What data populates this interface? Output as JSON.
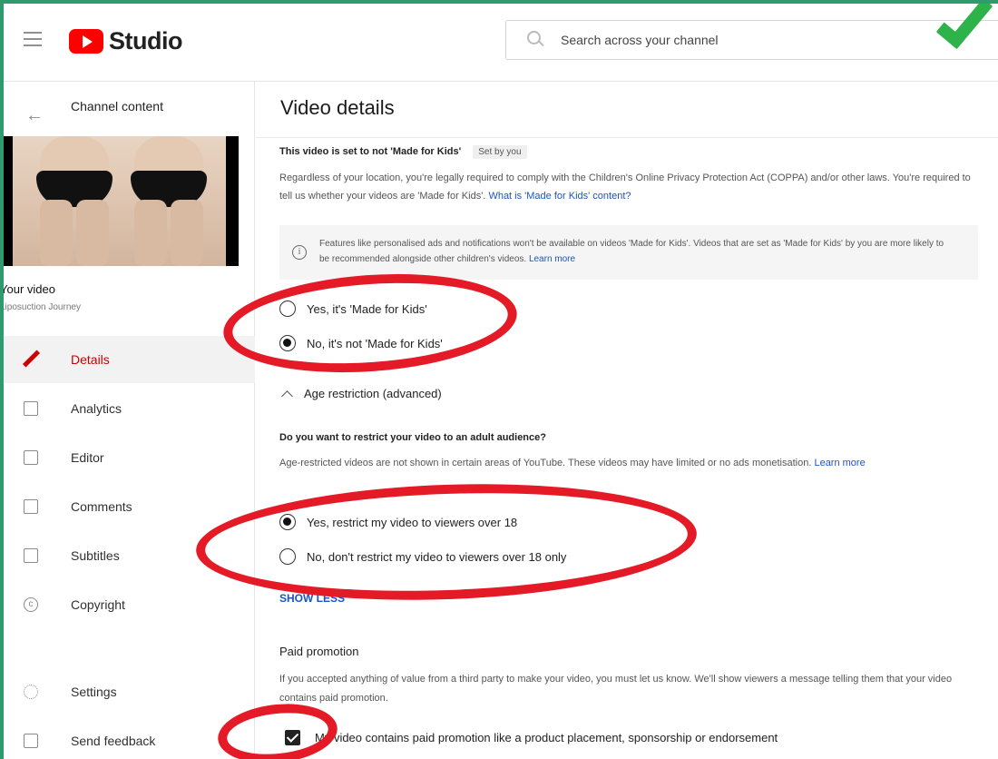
{
  "header": {
    "logo_text": "Studio",
    "search_placeholder": "Search across your channel"
  },
  "sidebar": {
    "back_label": "Channel content",
    "video_title": "Your video",
    "video_subtitle": "Liposuction Journey",
    "items": [
      {
        "label": "Details",
        "active": true
      },
      {
        "label": "Analytics"
      },
      {
        "label": "Editor"
      },
      {
        "label": "Comments"
      },
      {
        "label": "Subtitles"
      },
      {
        "label": "Copyright"
      },
      {
        "label": "Settings"
      },
      {
        "label": "Send feedback"
      }
    ]
  },
  "main": {
    "title": "Video details",
    "mfk": {
      "status": "This video is set to not 'Made for Kids'",
      "set_by": "Set by you",
      "description": "Regardless of your location, you're legally required to comply with the Children's Online Privacy Protection Act (COPPA) and/or other laws. You're required to tell us whether your videos are 'Made for Kids'.",
      "link": "What is 'Made for Kids' content?",
      "info": "Features like personalised ads and notifications won't be available on videos 'Made for Kids'. Videos that are set as 'Made for Kids' by you are more likely to be recommended alongside other children's videos.",
      "info_link": "Learn more",
      "option_yes": "Yes, it's 'Made for Kids'",
      "option_no": "No, it's not 'Made for Kids'"
    },
    "age": {
      "toggle_label": "Age restriction (advanced)",
      "question": "Do you want to restrict your video to an adult audience?",
      "description": "Age-restricted videos are not shown in certain areas of YouTube. These videos may have limited or no ads monetisation.",
      "learn_more": "Learn more",
      "option_yes": "Yes, restrict my video to viewers over 18",
      "option_no": "No, don't restrict my video to viewers over 18 only",
      "show_less": "SHOW LESS"
    },
    "paid": {
      "title": "Paid promotion",
      "description": "If you accepted anything of value from a third party to make your video, you must let us know. We'll show viewers a message telling them that your video contains paid promotion.",
      "checkbox_label": "My video contains paid promotion like a product placement, sponsorship or endorsement"
    }
  },
  "colors": {
    "accent_red": "#cc0000",
    "link_blue": "#1a55c4",
    "annotation_red": "#e51a27",
    "frame_green": "#2f9a6e"
  }
}
